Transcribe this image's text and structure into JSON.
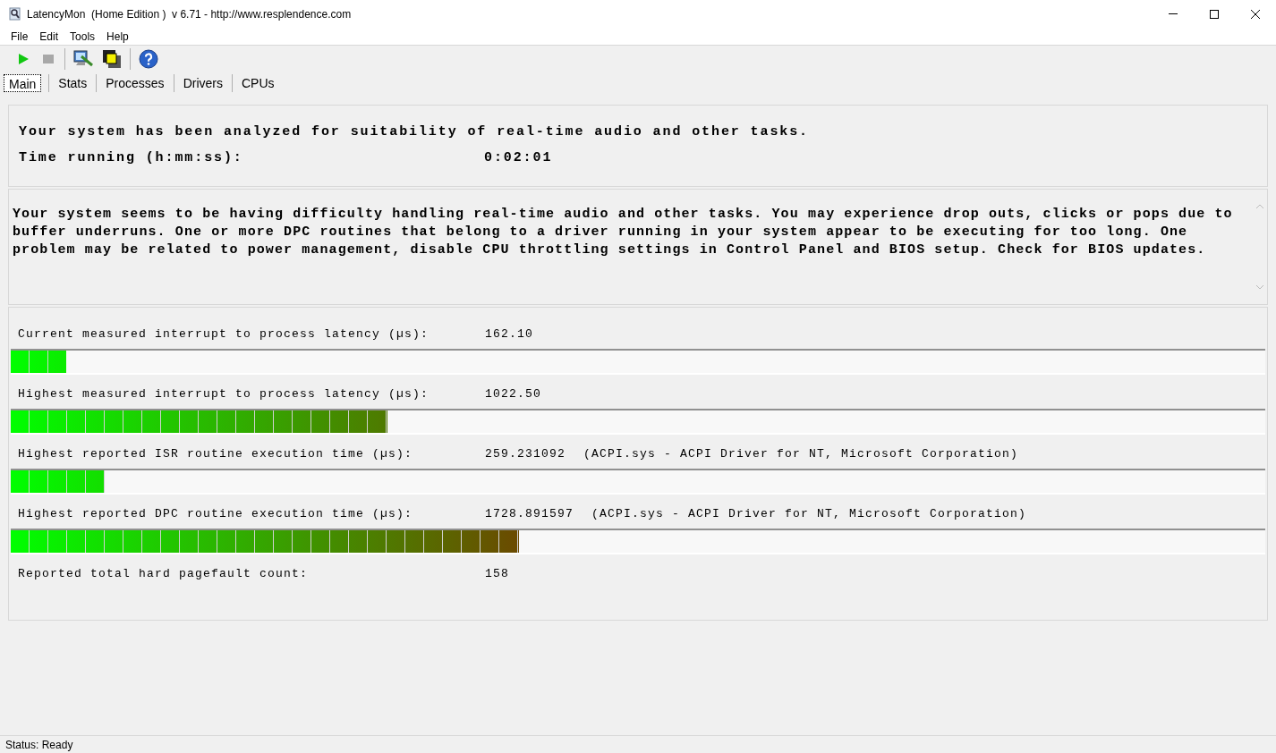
{
  "window": {
    "title": "LatencyMon  (Home Edition )  v 6.71 - http://www.resplendence.com"
  },
  "menu": [
    "File",
    "Edit",
    "Tools",
    "Help"
  ],
  "tabs": [
    {
      "label": "Main",
      "selected": true
    },
    {
      "label": "Stats",
      "selected": false
    },
    {
      "label": "Processes",
      "selected": false
    },
    {
      "label": "Drivers",
      "selected": false
    },
    {
      "label": "CPUs",
      "selected": false
    }
  ],
  "summary": {
    "headline": "Your system has been analyzed for suitability of real-time audio and other tasks.",
    "time_label": "Time running (h:mm:ss):",
    "time_value": "0:02:01"
  },
  "verdict": "Your system seems to be having difficulty handling real-time audio and other tasks. You may experience drop outs, clicks or pops due to buffer underruns. One or more DPC routines that belong to a driver running in your system appear to be executing for too long. One problem may be related to power management, disable CPU throttling settings in Control Panel and BIOS setup. Check for BIOS updates.",
  "metrics": [
    {
      "kind": "bar",
      "label": "Current measured interrupt to process latency (µs):",
      "value": "162.10",
      "level": 0.044
    },
    {
      "kind": "bar",
      "label": "Highest measured interrupt to process latency (µs):",
      "value": "1022.50",
      "level": 0.3
    },
    {
      "kind": "bar",
      "label": "Highest reported ISR routine execution time (µs):",
      "value": "259.231092",
      "detail": "(ACPI.sys - ACPI Driver for NT, Microsoft Corporation)",
      "level": 0.075
    },
    {
      "kind": "bar",
      "label": "Highest reported DPC routine execution time (µs):",
      "value": "1728.891597",
      "detail": "(ACPI.sys - ACPI Driver for NT, Microsoft Corporation)",
      "level": 0.405
    },
    {
      "kind": "text",
      "label": "Reported total hard pagefault count:",
      "value": "158"
    }
  ],
  "status_bar": "Status: Ready"
}
